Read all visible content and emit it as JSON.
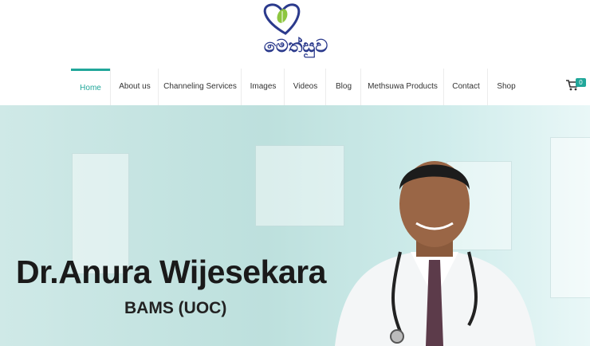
{
  "logo": {
    "text": "මෙත්සුව",
    "icon": "heart-leaf-logo"
  },
  "nav": {
    "items": [
      {
        "label": "Home",
        "active": true
      },
      {
        "label": "About us",
        "active": false
      },
      {
        "label": "Channeling Services",
        "active": false
      },
      {
        "label": "Images",
        "active": false
      },
      {
        "label": "Videos",
        "active": false
      },
      {
        "label": "Blog",
        "active": false
      },
      {
        "label": "Methsuwa Products",
        "active": false
      },
      {
        "label": "Contact",
        "active": false
      },
      {
        "label": "Shop",
        "active": false
      }
    ],
    "cart_icon": "shopping-cart-icon",
    "cart_count": "0"
  },
  "hero": {
    "name": "Dr.Anura Wijesekara",
    "credentials": "BAMS (UOC)",
    "image": "doctor-portrait"
  },
  "colors": {
    "accent": "#21a79a",
    "logo": "#2b3a8c"
  }
}
